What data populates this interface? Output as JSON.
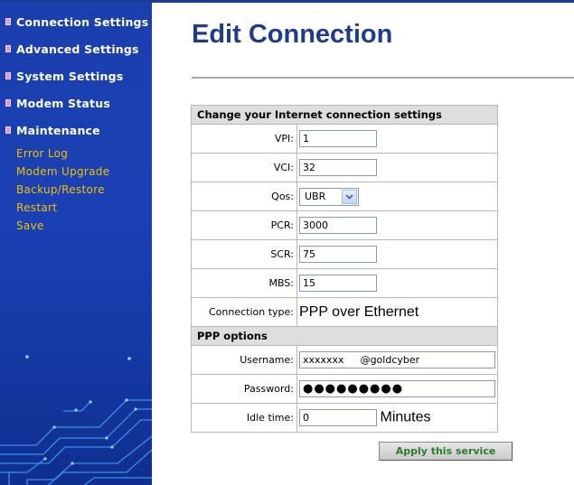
{
  "sidebar": {
    "sections": [
      {
        "label": "Connection Settings"
      },
      {
        "label": "Advanced Settings"
      },
      {
        "label": "System Settings"
      },
      {
        "label": "Modem Status"
      },
      {
        "label": "Maintenance"
      }
    ],
    "maintenance_items": [
      {
        "label": "Error Log"
      },
      {
        "label": "Modem Upgrade"
      },
      {
        "label": "Backup/Restore"
      },
      {
        "label": "Restart"
      },
      {
        "label": "Save"
      }
    ]
  },
  "page": {
    "title": "Edit Connection"
  },
  "form": {
    "section_internet": "Change your Internet connection settings",
    "vpi_label": "VPI:",
    "vpi_value": "1",
    "vci_label": "VCI:",
    "vci_value": "32",
    "qos_label": "Qos:",
    "qos_value": "UBR",
    "pcr_label": "PCR:",
    "pcr_value": "3000",
    "scr_label": "SCR:",
    "scr_value": "75",
    "mbs_label": "MBS:",
    "mbs_value": "15",
    "conn_type_label": "Connection type:",
    "conn_type_value": "PPP over Ethernet",
    "section_ppp": "PPP options",
    "username_label": "Username:",
    "username_value": "xxxxxxx",
    "username_suffix": "@goldcyber",
    "password_label": "Password:",
    "password_value": "●●●●●●●●●",
    "idle_label": "Idle time:",
    "idle_value": "0",
    "idle_unit": "Minutes"
  },
  "buttons": {
    "apply": "Apply this service"
  },
  "colors": {
    "sidebar_bg": "#1a40b4",
    "title": "#1f3c8c",
    "submenu_text": "#f0c000",
    "apply_text": "#2c7b2c"
  }
}
